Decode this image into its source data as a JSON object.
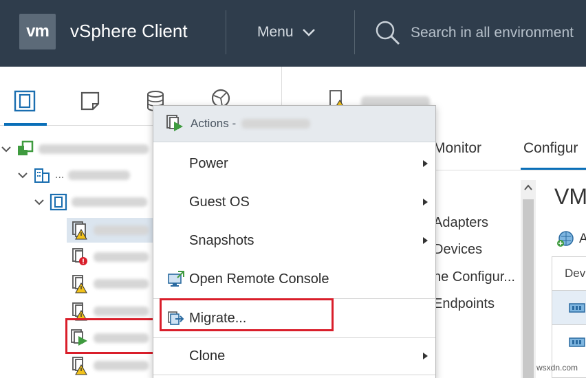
{
  "header": {
    "logo_text": "vm",
    "app_title": "vSphere Client",
    "menu_label": "Menu",
    "search_placeholder": "Search in all environment"
  },
  "nav_tabs": [
    "hosts-and-clusters-icon",
    "vms-and-templates-icon",
    "storage-icon",
    "networking-icon"
  ],
  "tree": {
    "row1_suffix": "",
    "row2_prefix": "..."
  },
  "right_pane": {
    "tabs": {
      "monitor": "Monitor",
      "configure": "Configur"
    },
    "config_items": [
      "Adapters",
      "Devices",
      "ne Configur...",
      "Endpoints"
    ],
    "section_title": "VM",
    "table_header": "Dev"
  },
  "context_menu": {
    "header_label": "Actions -",
    "items": [
      {
        "label": "Power",
        "submenu": true
      },
      {
        "label": "Guest OS",
        "submenu": true
      },
      {
        "label": "Snapshots",
        "submenu": true
      },
      {
        "label": "Open Remote Console",
        "submenu": false
      },
      {
        "label": "Migrate...",
        "submenu": false
      },
      {
        "label": "Clone",
        "submenu": true
      }
    ]
  },
  "watermark": "wsxdn.com",
  "colors": {
    "header_bg": "#2f3d4c",
    "accent_blue": "#0a6fb8",
    "highlight_red": "#d91e2a",
    "vm_green": "#3f9b3f",
    "warning_yellow": "#f2c21b"
  }
}
